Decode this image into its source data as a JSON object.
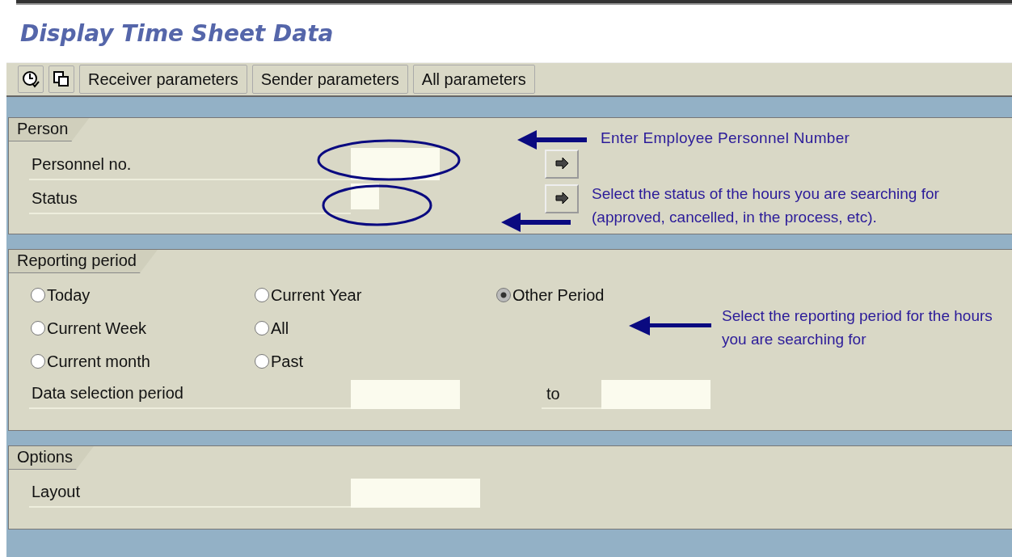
{
  "title": "Display Time Sheet Data",
  "toolbar": {
    "buttons": [
      "Receiver parameters",
      "Sender parameters",
      "All parameters"
    ]
  },
  "person": {
    "heading": "Person",
    "fields": [
      {
        "label": "Personnel no.",
        "circled": true
      },
      {
        "label": "Status",
        "circled": true
      }
    ]
  },
  "reporting_period": {
    "heading": "Reporting period",
    "options": [
      {
        "label": "Today",
        "selected": false
      },
      {
        "label": "Current Week",
        "selected": false
      },
      {
        "label": "Current month",
        "selected": false
      },
      {
        "label": "Current Year",
        "selected": false
      },
      {
        "label": "All",
        "selected": false
      },
      {
        "label": "Past",
        "selected": false
      },
      {
        "label": "Other Period",
        "selected": true
      }
    ],
    "data_selection_label": "Data selection period",
    "to_label": "to"
  },
  "options": {
    "heading": "Options",
    "layout_label": "Layout"
  },
  "annotations": [
    {
      "text": "Enter Employee Personnel Number"
    },
    {
      "text": "Select the status of the hours you are searching for (approved, cancelled, in the process, etc)."
    },
    {
      "text": "Select the reporting period for the hours you are searching for"
    }
  ]
}
